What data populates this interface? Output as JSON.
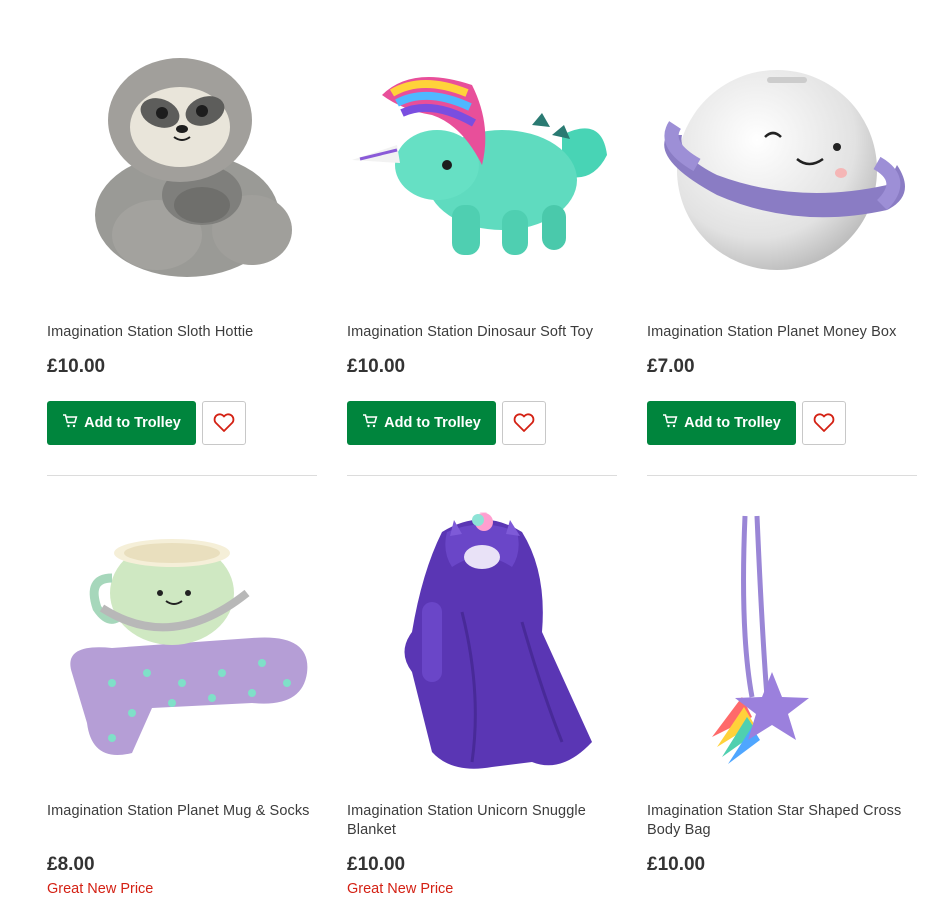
{
  "colors": {
    "trolley_green": "#00853d",
    "promo_red": "#d42114",
    "heart_red": "#d42114"
  },
  "products": [
    {
      "title": "Imagination Station Sloth Hottie",
      "price": "£10.00",
      "button": "Add to Trolley",
      "image_icon": "sloth-plush-image"
    },
    {
      "title": "Imagination Station Dinosaur Soft Toy",
      "price": "£10.00",
      "button": "Add to Trolley",
      "image_icon": "dinosaur-plush-image"
    },
    {
      "title": "Imagination Station Planet Money Box",
      "price": "£7.00",
      "button": "Add to Trolley",
      "image_icon": "planet-money-box-image"
    },
    {
      "title": "Imagination Station Planet Mug & Socks",
      "price": "£8.00",
      "promo": "Great New Price",
      "image_icon": "planet-mug-socks-image"
    },
    {
      "title": "Imagination Station Unicorn Snuggle Blanket",
      "price": "£10.00",
      "promo": "Great New Price",
      "image_icon": "unicorn-blanket-image"
    },
    {
      "title": "Imagination Station Star Shaped Cross Body Bag",
      "price": "£10.00",
      "image_icon": "star-bag-image"
    }
  ]
}
